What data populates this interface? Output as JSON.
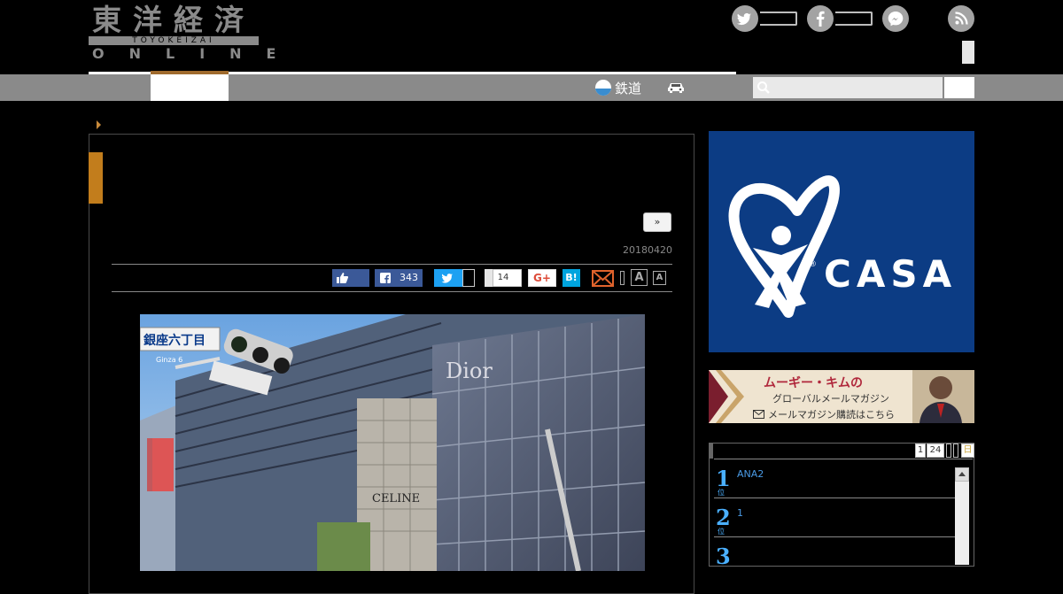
{
  "header": {
    "logo_kanji": "東洋経済",
    "logo_sub": "TOYOKEIZAI",
    "logo_online": "ONLINE"
  },
  "nav": {
    "rail_label": "鉄道",
    "rail_icon": "train-icon",
    "car_icon": "car-icon",
    "search_placeholder": ""
  },
  "social": {
    "icons": [
      "twitter-icon",
      "facebook-icon",
      "messenger-icon",
      "rss-icon"
    ]
  },
  "article": {
    "next_label": "»",
    "date": "20180420",
    "share": {
      "facebook_count": "343",
      "pocket_count": "14",
      "google_plus_label": "G+",
      "hatena_label": "B!"
    },
    "font_size_large": "A",
    "font_size_small": "A",
    "photo_sign_text": "銀座六丁目",
    "photo_sign_sub": "Ginza 6",
    "photo_brand_1": "Dior",
    "photo_brand_2": "CELINE"
  },
  "sidebar": {
    "ad_casa_text": "CASA",
    "ad_casa_reg": "®",
    "ad_banner_title": "ムーギー・キムの",
    "ad_banner_sub": "グローバルメールマガジン",
    "ad_banner_cta": "メールマガジン購読はこちら",
    "ranking": {
      "tabs": [
        "1",
        "24"
      ],
      "last_tab": "日",
      "items": [
        {
          "rank": "1",
          "title": "ANA2"
        },
        {
          "rank": "2",
          "title": "1"
        },
        {
          "rank": "3",
          "title": ""
        }
      ],
      "rank_suffix": "位"
    }
  },
  "colors": {
    "accent": "#c27d1c",
    "nav_bg": "#8a8a8a",
    "casa_bg": "#0c3c84",
    "twitter": "#1da1f2",
    "facebook": "#3b5998",
    "hatena": "#00a4de",
    "rank_blue": "#4ab0ff"
  }
}
